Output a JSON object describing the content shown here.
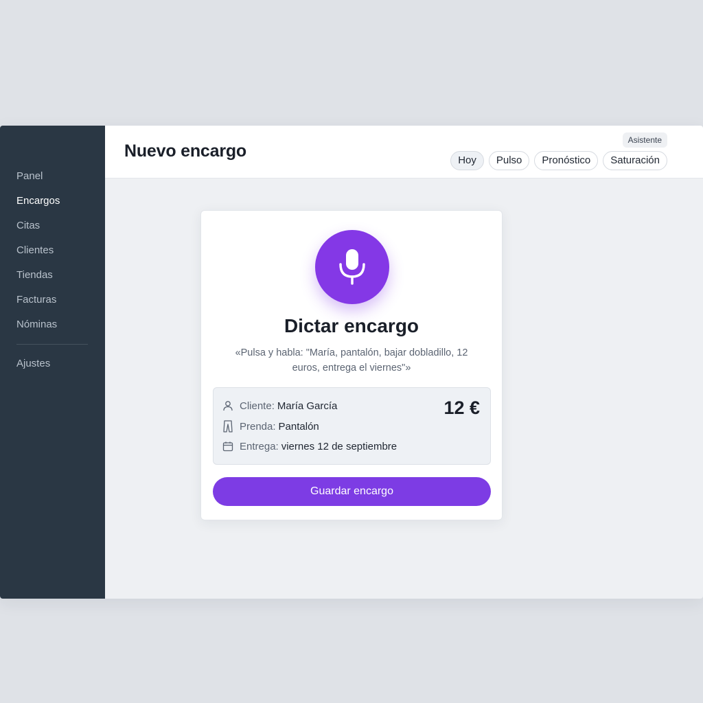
{
  "sidebar": {
    "items": [
      {
        "label": "Panel"
      },
      {
        "label": "Encargos"
      },
      {
        "label": "Citas"
      },
      {
        "label": "Clientes"
      },
      {
        "label": "Tiendas"
      },
      {
        "label": "Facturas"
      },
      {
        "label": "Nóminas"
      }
    ],
    "active": "Encargos",
    "settings_label": "Ajustes"
  },
  "header": {
    "title": "Nuevo encargo",
    "badge": "Asistente",
    "tabs": [
      {
        "label": "Hoy"
      },
      {
        "label": "Pulso"
      },
      {
        "label": "Pronóstico"
      },
      {
        "label": "Saturación"
      }
    ],
    "selected_tab": "Hoy"
  },
  "card": {
    "mic_icon": "microphone-icon",
    "title": "Dictar encargo",
    "hint": "«Pulsa y habla: \"María, pantalón, bajar dobladillo, 12 euros, entrega el viernes\"»",
    "summary": {
      "client_label": "Cliente:",
      "client_value": "María García",
      "garment_label": "Prenda:",
      "garment_value": "Pantalón",
      "delivery_label": "Entrega:",
      "delivery_value": "viernes 12 de septiembre",
      "price": "12 €"
    },
    "save_label": "Guardar encargo"
  },
  "colors": {
    "sidebar_bg": "#2a3744",
    "accent": "#7d3ce4",
    "mic": "#8438e6",
    "page_bg": "#eef0f3"
  }
}
